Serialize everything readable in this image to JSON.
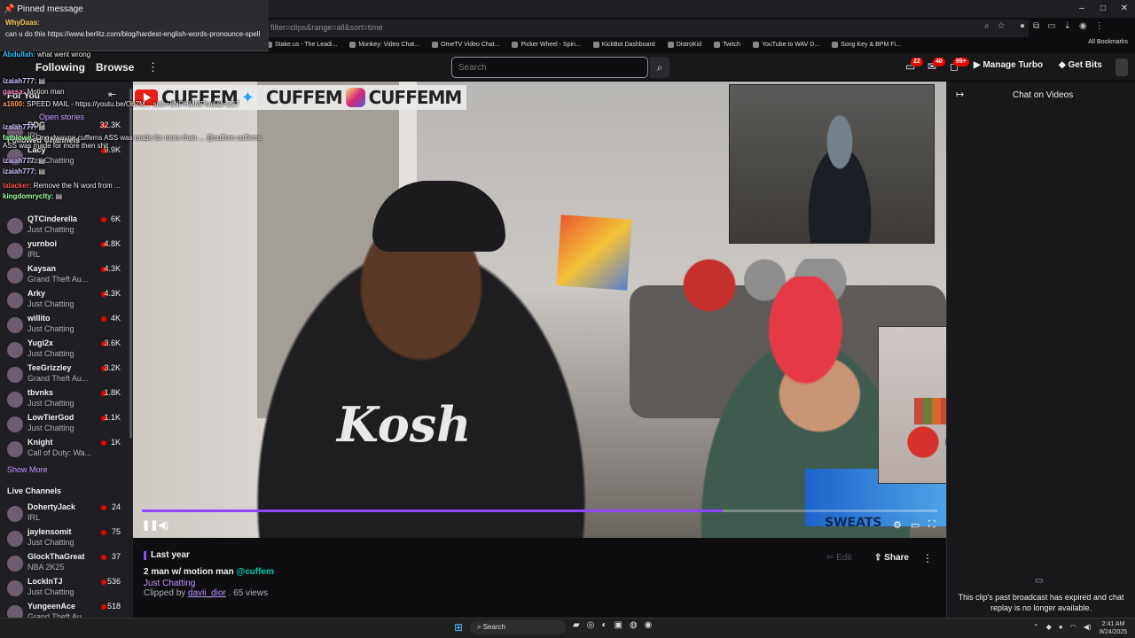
{
  "browser": {
    "url": "filter=clips&range=all&sort=time",
    "bookmarks": [
      "Stake.us - The Leadi...",
      "Monkey: Video Chat...",
      "OmeTV Video Chat...",
      "Picker Wheel - Spin...",
      "KickBot Dashboard",
      "DistroKid",
      "Twitch",
      "YouTube to WAV D...",
      "Song Key & BPM Fi..."
    ],
    "all_bookmarks": "All Bookmarks",
    "window_controls": [
      "–",
      "□",
      "✕"
    ]
  },
  "pinned": {
    "title": "Pinned message",
    "user": "WhyDaas:",
    "body": "can u do this https://www.berlitz.com/blog/hardest-english-words-pronounce-spell"
  },
  "chat_overlay": [
    {
      "user": "Abdullah:",
      "text": "what went wrong"
    },
    {
      "user": "",
      "text": "Following"
    },
    {
      "user": "izaiah777:",
      "text": "▤"
    },
    {
      "user": "gassa:",
      "text": "Motion man"
    },
    {
      "user": "a1600:",
      "text": "SPEED MAIL - https://youtu.be/Ob7M... sish=8NPHMMPIxdi&t=227"
    },
    {
      "user": "izaiah777:",
      "text": "▤"
    },
    {
      "user": "fatblowe:",
      "text": "Ong dwayne cuffems ASS was made for more than ... @cuffem cuffems ASS was made for more then shit"
    },
    {
      "user": "izaiah777:",
      "text": "▤"
    },
    {
      "user": "izaiah777:",
      "text": "▤"
    },
    {
      "user": "lalacker:",
      "text": "Remove the N word from ..."
    },
    {
      "user": "kingdomryclty:",
      "text": "▤"
    }
  ],
  "nav": {
    "following": "Following",
    "browse": "Browse",
    "search_placeholder": "Search",
    "badges": [
      "22",
      "40",
      "99+"
    ],
    "manage_turbo": "Manage Turbo",
    "get_bits": "Get Bits"
  },
  "sidebar": {
    "for_you": "For You",
    "open_stories": "Open stories",
    "followed_header": "Followed Channels",
    "followed": [
      {
        "name": "DDG",
        "category": "IRL",
        "viewers": "32.3K"
      },
      {
        "name": "Lacy",
        "category": "Just Chatting",
        "viewers": "9.9K"
      },
      {
        "name": "QTCinderella",
        "category": "Just Chatting",
        "viewers": "6K"
      },
      {
        "name": "yurnboi",
        "category": "IRL",
        "viewers": "4.8K"
      },
      {
        "name": "Kaysan",
        "category": "Grand Theft Au...",
        "viewers": "4.3K"
      },
      {
        "name": "Arky",
        "category": "Just Chatting",
        "viewers": "4.3K"
      },
      {
        "name": "willito",
        "category": "Just Chatting",
        "viewers": "4K"
      },
      {
        "name": "Yugi2x",
        "category": "Just Chatting",
        "viewers": "3.6K"
      },
      {
        "name": "TeeGrizzley",
        "category": "Grand Theft Au...",
        "viewers": "3.2K"
      },
      {
        "name": "tbvnks",
        "category": "Just Chatting",
        "viewers": "1.8K"
      },
      {
        "name": "LowTierGod",
        "category": "Just Chatting",
        "viewers": "1.1K"
      },
      {
        "name": "Knight",
        "category": "Call of Duty: Wa...",
        "viewers": "1K"
      }
    ],
    "show_more": "Show More",
    "live_header": "Live Channels",
    "live": [
      {
        "name": "DohertyJack",
        "category": "IRL",
        "viewers": "24"
      },
      {
        "name": "jaylensomit",
        "category": "Just Chatting",
        "viewers": "75"
      },
      {
        "name": "GlockThaGreat",
        "category": "NBA 2K25",
        "viewers": "37"
      },
      {
        "name": "LockInTJ",
        "category": "Just Chatting",
        "viewers": "536"
      },
      {
        "name": "YungeenAce",
        "category": "Grand Theft Au...",
        "viewers": "518"
      }
    ]
  },
  "video": {
    "banner_handles": [
      "CUFFEM",
      "CUFFEM",
      "CUFFEMM"
    ],
    "shirt_logo": "Kosh",
    "sticker_text": "SWEATS",
    "progress": 0.73
  },
  "clip": {
    "date": "Last year",
    "title": "2 man w/ motion man ",
    "mention": "@cuffem",
    "category": "Just Chatting",
    "clipped_by_prefix": "Clipped by ",
    "clipped_by_user": "davii_dior",
    "views": " . 65 views",
    "edit": "Edit",
    "share": "Share"
  },
  "chat_panel": {
    "title": "Chat on Videos",
    "expired": "This clip's past broadcast has expired and chat replay is no longer available."
  },
  "taskbar": {
    "search": "Search",
    "time": "2:41 AM",
    "date": "8/24/2025"
  },
  "colors": {
    "accent": "#9147ff",
    "live": "#eb0400",
    "link": "#bf94ff",
    "mention": "#00c8af"
  }
}
